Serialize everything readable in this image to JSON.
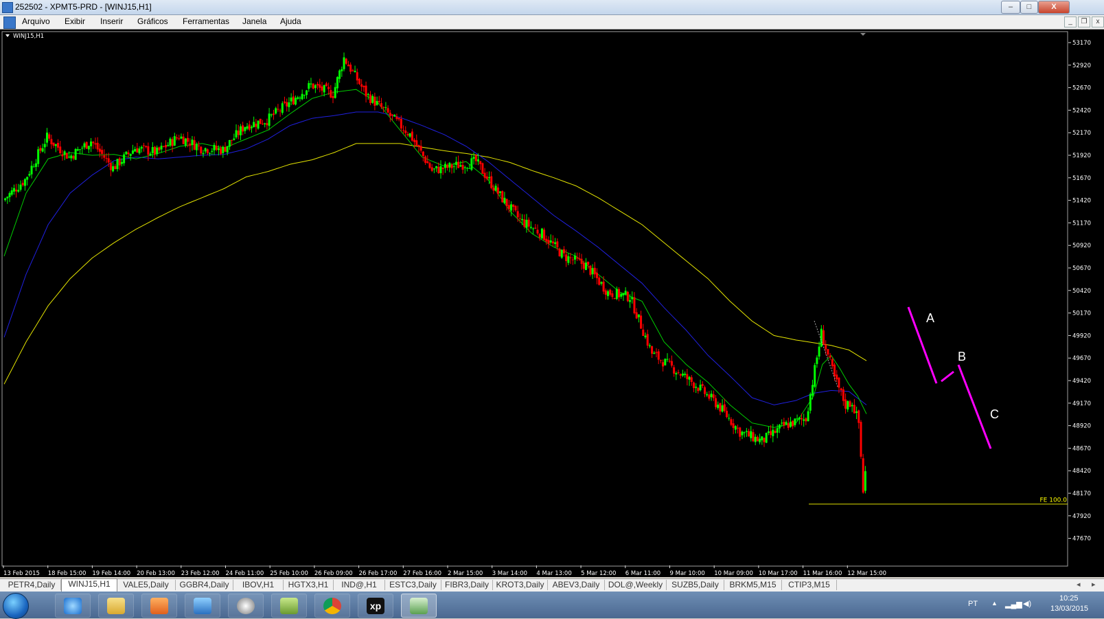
{
  "window": {
    "title": "252502 - XPMT5-PRD - [WINJ15,H1]",
    "minimize_label": "–",
    "maximize_label": "□",
    "close_label": "X"
  },
  "menu": {
    "items": [
      "Arquivo",
      "Exibir",
      "Inserir",
      "Gráficos",
      "Ferramentas",
      "Janela",
      "Ajuda"
    ],
    "mdi_minimize": "_",
    "mdi_restore": "❐",
    "mdi_close": "x"
  },
  "chart": {
    "symbol_label": "WINJ15,H1",
    "fe_label": "FE 100.0",
    "wave_labels": [
      "A",
      "B",
      "C"
    ],
    "colors": {
      "background": "#000000",
      "bull": "#00ff00",
      "bear": "#ff0000",
      "ma_fast": "#00cc00",
      "ma_mid": "#2020e0",
      "ma_slow": "#e6e600",
      "annotation": "#ff00ff"
    }
  },
  "chart_data": {
    "type": "candlestick",
    "y_ticks": [
      "53170",
      "52920",
      "52670",
      "52420",
      "52170",
      "51920",
      "51670",
      "51420",
      "51170",
      "50920",
      "50670",
      "50420",
      "50170",
      "49920",
      "49670",
      "49420",
      "49170",
      "48920",
      "48670",
      "48420",
      "48170",
      "47920",
      "47670"
    ],
    "x_ticks": [
      "13 Feb 2015",
      "18 Feb 15:00",
      "19 Feb 14:00",
      "20 Feb 13:00",
      "23 Feb 12:00",
      "24 Feb 11:00",
      "25 Feb 10:00",
      "26 Feb 09:00",
      "26 Feb 17:00",
      "27 Feb 16:00",
      "2 Mar 15:00",
      "3 Mar 14:00",
      "4 Mar 13:00",
      "5 Mar 12:00",
      "6 Mar 11:00",
      "9 Mar 10:00",
      "10 Mar 09:00",
      "10 Mar 17:00",
      "11 Mar 16:00",
      "12 Mar 15:00"
    ],
    "ylim": [
      47600,
      53250
    ],
    "fe_level": 48050,
    "close_path": [
      [
        0,
        51420
      ],
      [
        10,
        51650
      ],
      [
        20,
        52120
      ],
      [
        30,
        51900
      ],
      [
        40,
        52080
      ],
      [
        50,
        51780
      ],
      [
        60,
        52000
      ],
      [
        70,
        51950
      ],
      [
        80,
        52130
      ],
      [
        90,
        52000
      ],
      [
        100,
        51980
      ],
      [
        110,
        52250
      ],
      [
        120,
        52310
      ],
      [
        130,
        52500
      ],
      [
        140,
        52700
      ],
      [
        150,
        52600
      ],
      [
        155,
        53000
      ],
      [
        165,
        52600
      ],
      [
        175,
        52380
      ],
      [
        185,
        52150
      ],
      [
        195,
        51750
      ],
      [
        205,
        51800
      ],
      [
        215,
        51850
      ],
      [
        225,
        51500
      ],
      [
        235,
        51200
      ],
      [
        245,
        51050
      ],
      [
        255,
        50800
      ],
      [
        265,
        50700
      ],
      [
        275,
        50400
      ],
      [
        285,
        50350
      ],
      [
        295,
        49720
      ],
      [
        305,
        49550
      ],
      [
        315,
        49370
      ],
      [
        325,
        49150
      ],
      [
        335,
        48850
      ],
      [
        345,
        48750
      ],
      [
        355,
        48920
      ],
      [
        365,
        49000
      ],
      [
        372,
        49950
      ],
      [
        378,
        49450
      ],
      [
        383,
        49150
      ],
      [
        386,
        49180
      ],
      [
        389,
        48950
      ],
      [
        391,
        48200
      ],
      [
        392,
        48400
      ]
    ],
    "ma_fast_path": [
      [
        0,
        50800
      ],
      [
        10,
        51500
      ],
      [
        20,
        51880
      ],
      [
        30,
        51950
      ],
      [
        40,
        51920
      ],
      [
        50,
        51930
      ],
      [
        60,
        51880
      ],
      [
        70,
        51940
      ],
      [
        80,
        52020
      ],
      [
        90,
        52050
      ],
      [
        100,
        52000
      ],
      [
        110,
        52100
      ],
      [
        120,
        52200
      ],
      [
        130,
        52380
      ],
      [
        140,
        52550
      ],
      [
        150,
        52620
      ],
      [
        160,
        52650
      ],
      [
        170,
        52500
      ],
      [
        180,
        52200
      ],
      [
        190,
        51900
      ],
      [
        200,
        51800
      ],
      [
        210,
        51850
      ],
      [
        220,
        51650
      ],
      [
        230,
        51300
      ],
      [
        240,
        51050
      ],
      [
        250,
        50900
      ],
      [
        260,
        50800
      ],
      [
        270,
        50600
      ],
      [
        280,
        50400
      ],
      [
        290,
        50300
      ],
      [
        300,
        49850
      ],
      [
        310,
        49600
      ],
      [
        320,
        49400
      ],
      [
        330,
        49150
      ],
      [
        340,
        48950
      ],
      [
        350,
        48900
      ],
      [
        360,
        48950
      ],
      [
        368,
        49250
      ],
      [
        372,
        49600
      ],
      [
        376,
        49700
      ],
      [
        380,
        49550
      ],
      [
        384,
        49380
      ],
      [
        388,
        49250
      ],
      [
        392,
        49050
      ]
    ],
    "ma_mid_path": [
      [
        0,
        49900
      ],
      [
        10,
        50600
      ],
      [
        20,
        51150
      ],
      [
        30,
        51500
      ],
      [
        40,
        51700
      ],
      [
        50,
        51860
      ],
      [
        60,
        51900
      ],
      [
        70,
        51880
      ],
      [
        80,
        51900
      ],
      [
        90,
        51920
      ],
      [
        100,
        51930
      ],
      [
        110,
        51990
      ],
      [
        120,
        52100
      ],
      [
        130,
        52250
      ],
      [
        140,
        52330
      ],
      [
        150,
        52360
      ],
      [
        160,
        52400
      ],
      [
        170,
        52400
      ],
      [
        180,
        52340
      ],
      [
        190,
        52250
      ],
      [
        200,
        52150
      ],
      [
        210,
        52020
      ],
      [
        220,
        51850
      ],
      [
        230,
        51650
      ],
      [
        240,
        51450
      ],
      [
        250,
        51250
      ],
      [
        260,
        51080
      ],
      [
        270,
        50900
      ],
      [
        280,
        50700
      ],
      [
        290,
        50500
      ],
      [
        300,
        50230
      ],
      [
        310,
        49980
      ],
      [
        320,
        49700
      ],
      [
        330,
        49470
      ],
      [
        340,
        49230
      ],
      [
        350,
        49150
      ],
      [
        360,
        49200
      ],
      [
        368,
        49280
      ],
      [
        376,
        49310
      ],
      [
        384,
        49300
      ],
      [
        392,
        49150
      ]
    ],
    "ma_slow_path": [
      [
        0,
        49380
      ],
      [
        10,
        49850
      ],
      [
        20,
        50250
      ],
      [
        30,
        50550
      ],
      [
        40,
        50780
      ],
      [
        50,
        50950
      ],
      [
        60,
        51100
      ],
      [
        70,
        51230
      ],
      [
        80,
        51350
      ],
      [
        90,
        51450
      ],
      [
        100,
        51550
      ],
      [
        110,
        51680
      ],
      [
        120,
        51740
      ],
      [
        130,
        51820
      ],
      [
        140,
        51870
      ],
      [
        150,
        51950
      ],
      [
        160,
        52050
      ],
      [
        170,
        52050
      ],
      [
        180,
        52050
      ],
      [
        190,
        52010
      ],
      [
        200,
        51970
      ],
      [
        210,
        51940
      ],
      [
        220,
        51900
      ],
      [
        230,
        51840
      ],
      [
        240,
        51750
      ],
      [
        250,
        51670
      ],
      [
        260,
        51580
      ],
      [
        270,
        51450
      ],
      [
        280,
        51300
      ],
      [
        290,
        51150
      ],
      [
        300,
        50950
      ],
      [
        310,
        50750
      ],
      [
        320,
        50550
      ],
      [
        330,
        50300
      ],
      [
        340,
        50080
      ],
      [
        350,
        49920
      ],
      [
        360,
        49870
      ],
      [
        368,
        49840
      ],
      [
        376,
        49810
      ],
      [
        384,
        49760
      ],
      [
        392,
        49640
      ]
    ]
  },
  "tabs": [
    "PETR4,Daily",
    "WINJ15,H1",
    "VALE5,Daily",
    "GGBR4,Daily",
    "IBOV,H1",
    "HGTX3,H1",
    "IND@,H1",
    "ESTC3,Daily",
    "FIBR3,Daily",
    "KROT3,Daily",
    "ABEV3,Daily",
    "DOL@,Weekly",
    "SUZB5,Daily",
    "BRKM5,M15",
    "CTIP3,M15"
  ],
  "active_tab": "WINJ15,H1",
  "tab_nav": {
    "prev": "◂",
    "next": "▸"
  },
  "taskbar": {
    "apps": [
      "internet-explorer",
      "file-explorer",
      "media-player",
      "mt5-terminal",
      "hp-tool",
      "archive-tool",
      "chrome",
      "xp-investimentos",
      "chart-app"
    ],
    "xp_label": "xp",
    "language": "PT",
    "time": "10:25",
    "date": "13/03/2015"
  }
}
